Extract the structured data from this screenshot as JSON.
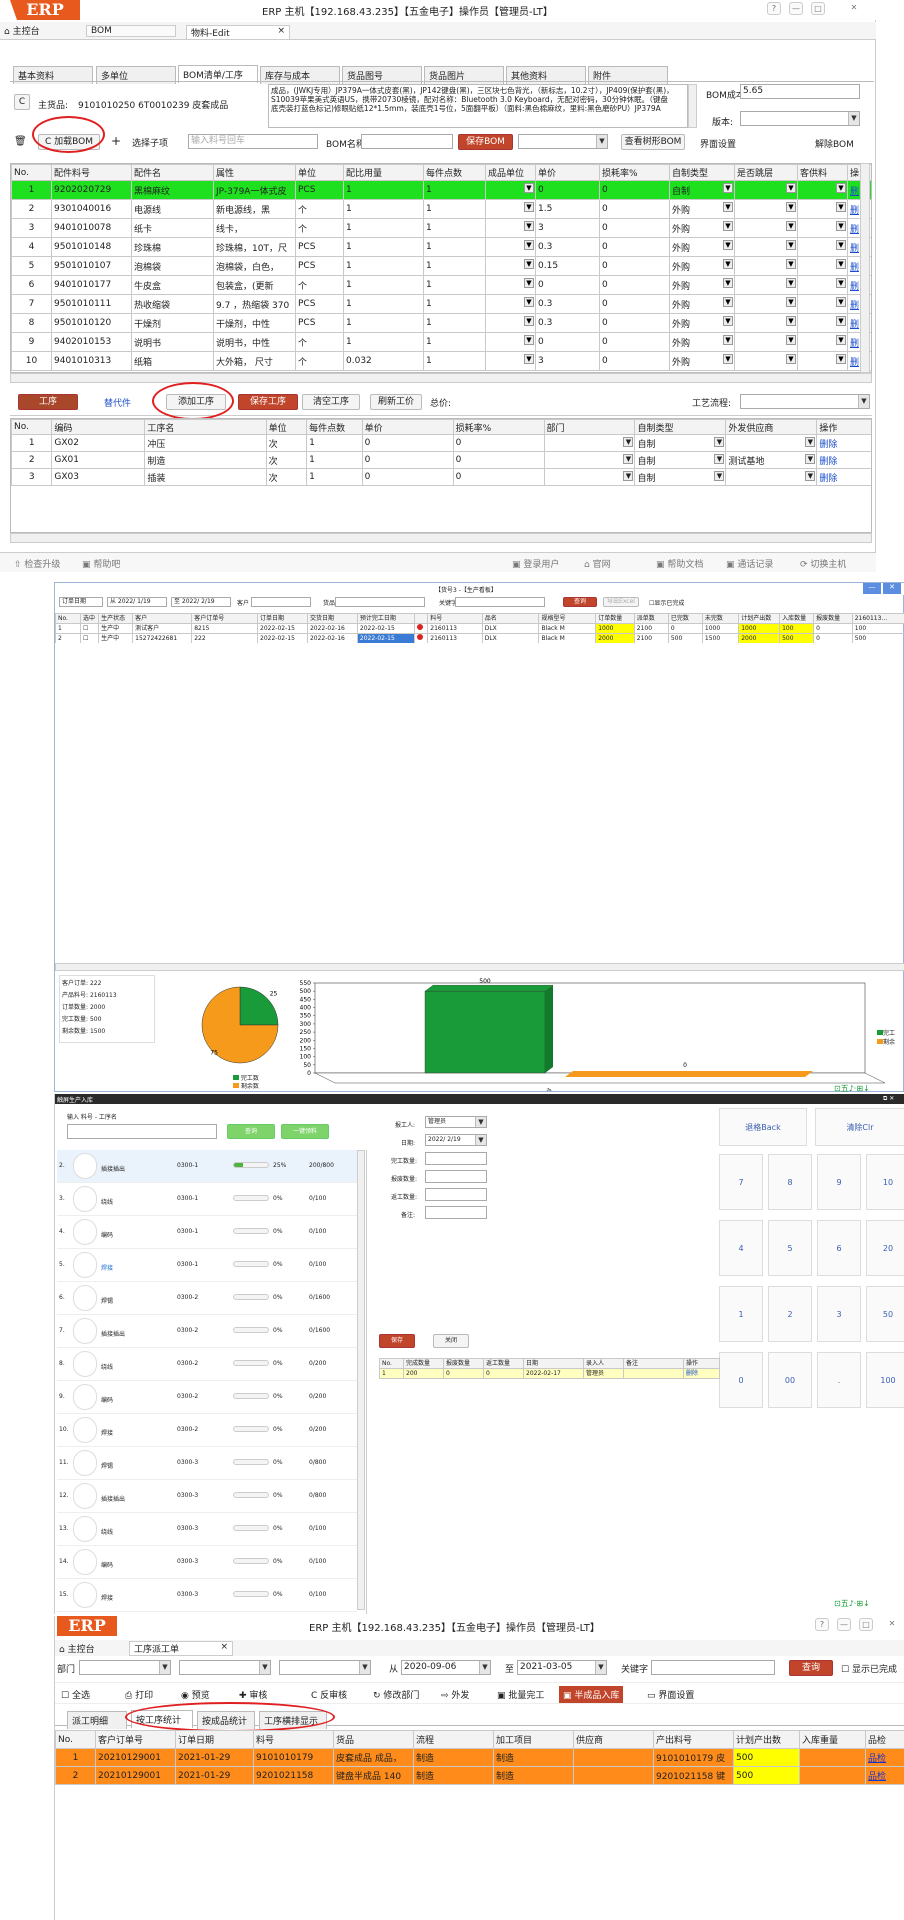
{
  "p1": {
    "logo": "ERP",
    "title": "ERP 主机【192.168.43.235】【五金电子】操作员【管理员-LT】",
    "win_btns": [
      "?",
      "—",
      "□",
      "✕"
    ],
    "top_tabs": [
      "主控台",
      "BOM",
      "物料-Edit"
    ],
    "top_tab_close": "×",
    "tabs": [
      "基本资料",
      "多单位",
      "BOM清单/工序",
      "库存与成本",
      "货品图号",
      "货品图片",
      "其他资料",
      "附件"
    ],
    "main_product_label": "主货品:",
    "main_product_value": "9101010250  6T0010239  皮套成品",
    "refresh_icon": "C",
    "desc": "成品，(JWKJ专用）JP379A一体式皮套(黑)，JP142键盘(黑)，三区块七色背光，（新标志，10.2寸），JP409(保护套(黑)，S10039苹果美式英语US，携带20730棱镜，配对名称：Bluetooth 3.0 Keyboard，无配对密码，30分钟休眠。（键盘底壳装打蓝色标记)修眼贴纸12*1.5mm，装底壳1号位，5面翻平板）（面料:黑色棉麻纹，里料:黑色磨砂PU）JP379A",
    "bom_cost_label": "BOM成本",
    "bom_cost_value": "5.65",
    "version_label": "版本:",
    "toolbar": {
      "load_bom": "加载BOM",
      "add": "+",
      "select_child": "选择子项",
      "search_placeholder": "输入料号回车",
      "bom_name_label": "BOM名称",
      "save_bom": "保存BOM",
      "view_tree": "查看树形BOM",
      "ui_settings": "界面设置",
      "unlock_bom": "解除BOM"
    },
    "bom_headers": [
      "No.",
      "配件料号",
      "配件名",
      "属性",
      "单位",
      "配比用量",
      "每件点数",
      "成品单位",
      "单价",
      "损耗率%",
      "自制类型",
      "是否跳层",
      "客供料",
      "操"
    ],
    "bom_rows": [
      [
        "1",
        "9202020729",
        "黑棉麻纹",
        "JP-379A一体式皮",
        "PCS",
        "1",
        "1",
        "",
        "0",
        "0",
        "自制",
        "",
        "",
        ""
      ],
      [
        "2",
        "9301040016",
        "电源线",
        "新电源线，黑",
        "个",
        "1",
        "1",
        "",
        "1.5",
        "0",
        "外购",
        "",
        "",
        ""
      ],
      [
        "3",
        "9401010078",
        "纸卡",
        "线卡，",
        "个",
        "1",
        "1",
        "",
        "3",
        "0",
        "外购",
        "",
        "",
        ""
      ],
      [
        "4",
        "9501010148",
        "珍珠棉",
        "珍珠棉，10T，尺",
        "PCS",
        "1",
        "1",
        "",
        "0.3",
        "0",
        "外购",
        "",
        "",
        ""
      ],
      [
        "5",
        "9501010107",
        "泡棉袋",
        "泡棉袋，白色，",
        "PCS",
        "1",
        "1",
        "",
        "0.15",
        "0",
        "外购",
        "",
        "",
        ""
      ],
      [
        "6",
        "9401010177",
        "牛皮盒",
        "包装盒，(更新",
        "个",
        "1",
        "1",
        "",
        "0",
        "0",
        "外购",
        "",
        "",
        ""
      ],
      [
        "7",
        "9501010111",
        "热收缩袋",
        "9.7  ，热缩袋 370",
        "PCS",
        "1",
        "1",
        "",
        "0.3",
        "0",
        "外购",
        "",
        "",
        ""
      ],
      [
        "8",
        "9501010120",
        "干燥剂",
        "干燥剂，中性",
        "PCS",
        "1",
        "1",
        "",
        "0.3",
        "0",
        "外购",
        "",
        "",
        ""
      ],
      [
        "9",
        "9402010153",
        "说明书",
        "说明书，中性",
        "个",
        "1",
        "1",
        "",
        "0",
        "0",
        "外购",
        "",
        "",
        ""
      ],
      [
        "10",
        "9401010313",
        "纸箱",
        "大外箱，  尺寸",
        "个",
        "0.032",
        "1",
        "",
        "3",
        "0",
        "外购",
        "",
        "",
        ""
      ]
    ],
    "row_action": "删",
    "proc_bar": {
      "process": "工序",
      "parts": "替代件",
      "add_process": "添加工序",
      "save_process": "保存工序",
      "clear_process": "清空工序",
      "refresh": "刷新工价",
      "total": "总价:",
      "flow": "工艺流程:"
    },
    "proc_headers": [
      "No.",
      "编码",
      "工序名",
      "单位",
      "每件点数",
      "单价",
      "损耗率%",
      "部门",
      "自制类型",
      "外发供应商",
      "操作"
    ],
    "proc_rows": [
      [
        "1",
        "GX02",
        "冲压",
        "次",
        "1",
        "0",
        "0",
        "",
        "自制",
        "",
        "删除"
      ],
      [
        "2",
        "GX01",
        "制造",
        "次",
        "1",
        "0",
        "0",
        "",
        "自制",
        "测试基地",
        "删除"
      ],
      [
        "3",
        "GX03",
        "插装",
        "次",
        "1",
        "0",
        "0",
        "",
        "自制",
        "",
        "删除"
      ]
    ],
    "status": [
      "检查升级",
      "帮助吧",
      "登录用户",
      "官网",
      "帮助文档",
      "通话记录",
      "切换主机"
    ]
  },
  "p2": {
    "title": "【货号3 -【生产看板】",
    "filters": {
      "date_type": "订单日期",
      "from": "从 2022/ 1/19",
      "to": "至 2022/ 2/19",
      "customer": "客户",
      "goods": "货品",
      "keyword": "关键字",
      "query": "查询",
      "export": "导出Excel",
      "show_done": "显示已完成"
    },
    "headers": [
      "No.",
      "选中",
      "生产状态",
      "客户",
      "客户订单号",
      "订单日期",
      "交货日期",
      "预计完工日期",
      "",
      "料号",
      "品名",
      "规格型号",
      "订单数量",
      "派单数",
      "已完数",
      "未完数",
      "计划产出数",
      "入库数量",
      "报废数量",
      "2160113..."
    ],
    "rows": [
      [
        "1",
        "",
        "生产中",
        "测试客户",
        "8215",
        "2022-02-15",
        "2022-02-16",
        "2022-02-15",
        "",
        "2160113",
        "DLX",
        "Black M",
        "1000",
        "2100",
        "0",
        "1000",
        "1000",
        "100",
        "0",
        "100"
      ],
      [
        "2",
        "",
        "生产中",
        "15272422681",
        "222",
        "2022-02-15",
        "2022-02-16",
        "2022-02-15",
        "",
        "2160113",
        "DLX",
        "Black M",
        "2000",
        "2100",
        "500",
        "1500",
        "2000",
        "500",
        "0",
        "500"
      ]
    ],
    "total_label": "合计:",
    "info": {
      "labels": [
        "客户订单:",
        "产品料号:",
        "订单数量:",
        "完工数量:",
        "剩余数量:"
      ],
      "values": [
        "222",
        "2160113",
        "2000",
        "500",
        "1500"
      ]
    },
    "legend": [
      "完工数",
      "剩余数"
    ],
    "legend_right": [
      "完工",
      "剩余"
    ],
    "pie_labels": [
      "25",
      "75"
    ],
    "ylabels": [
      "550",
      "500",
      "450",
      "400",
      "350",
      "300",
      "250",
      "200",
      "150",
      "100",
      "50",
      "0"
    ],
    "bar_labels": [
      "500",
      "0"
    ],
    "bar_cat": "完工",
    "chart_data": {
      "type": "bar",
      "categories": [
        "完工数",
        "剩余数"
      ],
      "values": [
        500,
        0
      ],
      "ylim": [
        0,
        550
      ]
    },
    "pie_data": {
      "type": "pie",
      "values": [
        25,
        75
      ],
      "colors": [
        "#1a9b3a",
        "#f59a1b"
      ]
    }
  },
  "p3": {
    "title": "触屏生产入库",
    "search_label": "输入 料号 - 工序名",
    "query": "查询",
    "scan": "一键领料",
    "items": [
      [
        "2.",
        "插接插出",
        "0300-1",
        "25%",
        "200/800"
      ],
      [
        "3.",
        "绕线",
        "0300-1",
        "0%",
        "0/100"
      ],
      [
        "4.",
        "编码",
        "0300-1",
        "0%",
        "0/100"
      ],
      [
        "5.",
        "焊接",
        "0300-1",
        "0%",
        "0/100"
      ],
      [
        "6.",
        "焊锡",
        "0300-2",
        "0%",
        "0/1600"
      ],
      [
        "7.",
        "插接插出",
        "0300-2",
        "0%",
        "0/1600"
      ],
      [
        "8.",
        "绕线",
        "0300-2",
        "0%",
        "0/200"
      ],
      [
        "9.",
        "编码",
        "0300-2",
        "0%",
        "0/200"
      ],
      [
        "10.",
        "焊接",
        "0300-2",
        "0%",
        "0/200"
      ],
      [
        "11.",
        "焊锡",
        "0300-3",
        "0%",
        "0/800"
      ],
      [
        "12.",
        "插接插出",
        "0300-3",
        "0%",
        "0/800"
      ],
      [
        "13.",
        "绕线",
        "0300-3",
        "0%",
        "0/100"
      ],
      [
        "14.",
        "编码",
        "0300-3",
        "0%",
        "0/100"
      ],
      [
        "15.",
        "焊接",
        "0300-3",
        "0%",
        "0/100"
      ]
    ],
    "form": {
      "labels": [
        "报工人:",
        "日期:",
        "完工数量:",
        "报废数量:",
        "返工数量:",
        "备注:"
      ],
      "worker": "管理员",
      "date": "2022/ 2/19"
    },
    "keys": [
      "退格Back",
      "清除Clr",
      "7",
      "8",
      "9",
      "10",
      "4",
      "5",
      "6",
      "20",
      "1",
      "2",
      "3",
      "50",
      "0",
      "00",
      ".",
      "100"
    ],
    "save": "保存",
    "close": "关闭",
    "rec_headers": [
      "No.",
      "完成数量",
      "报废数量",
      "返工数量",
      "日期",
      "录入人",
      "备注",
      "操作"
    ],
    "rec_row": [
      "1",
      "200",
      "0",
      "0",
      "2022-02-17",
      "管理员",
      "",
      "删除"
    ]
  },
  "p4": {
    "logo": "ERP",
    "title": "ERP 主机【192.168.43.235】【五金电子】操作员【管理员-LT】",
    "tabs": [
      "主控台",
      "工序派工单"
    ],
    "filters": {
      "dept": "部门",
      "from": "从",
      "from_date": "2020-09-06",
      "to": "至",
      "to_date": "2021-03-05",
      "keyword": "关键字",
      "query": "查询",
      "show_done": "显示已完成"
    },
    "toolbar": [
      "全选",
      "打印",
      "预览",
      "审核",
      "反审核",
      "修改部门",
      "外发",
      "批量完工",
      "半成品入库",
      "界面设置"
    ],
    "subtabs": [
      "派工明细",
      "按工序统计",
      "按成品统计",
      "工序横排显示"
    ],
    "headers": [
      "No.",
      "客户订单号",
      "订单日期",
      "料号",
      "货品",
      "流程",
      "加工项目",
      "供应商",
      "产出料号",
      "计划产出数",
      "入库重量",
      "品检"
    ],
    "rows": [
      [
        "1",
        "20210129001",
        "2021-01-29",
        "9101010179",
        "皮套成品 成品，",
        "制造",
        "制造",
        "",
        "9101010179 皮",
        "500",
        "",
        "品检"
      ],
      [
        "2",
        "20210129001",
        "2021-01-29",
        "9201021158",
        "键盘半成品 140",
        "制造",
        "制造",
        "",
        "9201021158 键",
        "500",
        "",
        "品检"
      ]
    ]
  },
  "colors": {
    "green": "#1fe01f",
    "orange": "#ff8c1a",
    "yellow": "#ffff00",
    "accent": "#c0452a",
    "blue_link": "#1a4dcc"
  }
}
